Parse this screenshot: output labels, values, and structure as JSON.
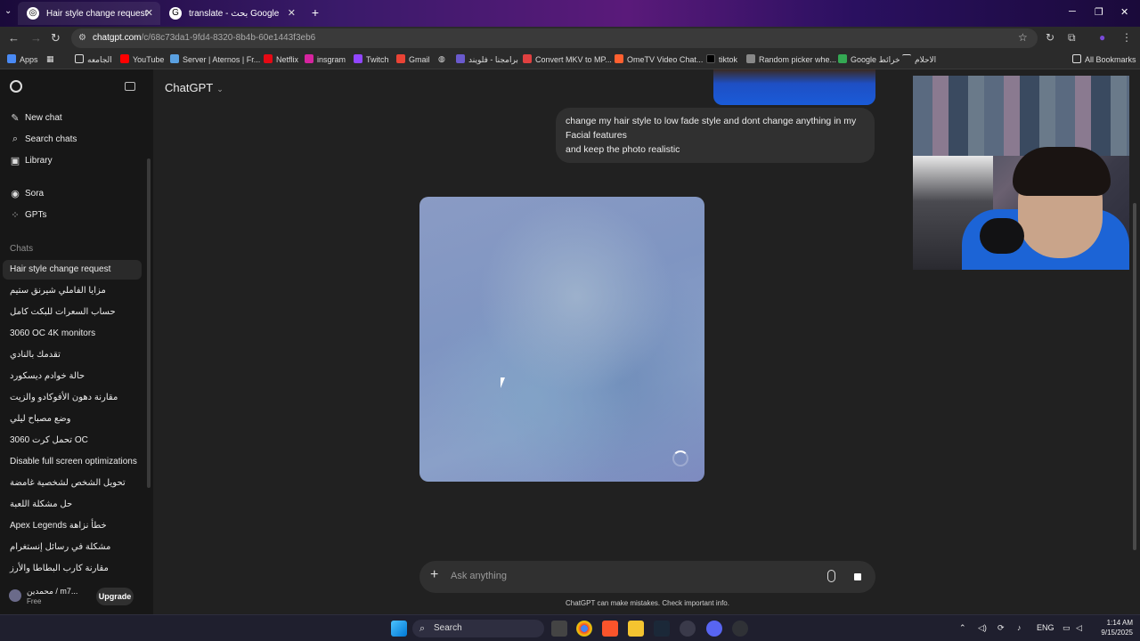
{
  "browser": {
    "tabs": [
      {
        "title": "Hair style change request",
        "active": true
      },
      {
        "title": "translate - بحث Google",
        "active": false
      }
    ],
    "url_host": "chatgpt.com",
    "url_path": "/c/68c73da1-9fd4-8320-8b4b-60e1443f3eb6",
    "bookmarks": [
      "Apps",
      "الجامعه",
      "YouTube",
      "Server | Aternos | Fr...",
      "Netflix",
      "insgram",
      "Twitch",
      "Gmail",
      "برامجنا - فلويند",
      "Convert MKV to MP...",
      "OmeTV Video Chat...",
      "tiktok",
      "Random picker whe...",
      "Google خرائط",
      "الاحلام",
      "All Bookmarks"
    ]
  },
  "sidebar": {
    "nav": [
      {
        "label": "New chat",
        "icon": "pencil-icon"
      },
      {
        "label": "Search chats",
        "icon": "search-icon"
      },
      {
        "label": "Library",
        "icon": "library-icon"
      },
      {
        "label": "Sora",
        "icon": "sora-icon"
      },
      {
        "label": "GPTs",
        "icon": "grid-icon"
      }
    ],
    "chats_header": "Chats",
    "chats": [
      "Hair style change request",
      "مزايا الفاملي شيرنق ستيم",
      "حساب السعرات للبكت كامل",
      "3060 OC 4K monitors",
      "تقدمك بالنادي",
      "حالة خوادم ديسكورد",
      "مقارنة دهون الأفوكادو والزيت",
      "وضع مصباح ليلي",
      "تحمل كرت 3060 OC",
      "Disable full screen optimizations",
      "تحويل الشخص لشخصية غامضة",
      "حل مشكلة اللعبة",
      "Apex Legends خطأ نزاهة",
      "مشكلة في رسائل إنستغرام",
      "مقارنة كارب البطاطا والأرز"
    ],
    "user": {
      "name": "محمدين / m7...",
      "plan": "Free",
      "upgrade": "Upgrade"
    }
  },
  "main": {
    "model": "ChatGPT",
    "user_message": [
      "change my hair style to low fade style and dont change anything in my",
      "Facial features",
      "and keep the photo realistic"
    ],
    "composer_placeholder": "Ask anything",
    "disclaimer": "ChatGPT can make mistakes. Check important info."
  },
  "taskbar": {
    "search": "Search",
    "lang": "ENG",
    "time": "1:14 AM",
    "date": "9/15/2025"
  }
}
